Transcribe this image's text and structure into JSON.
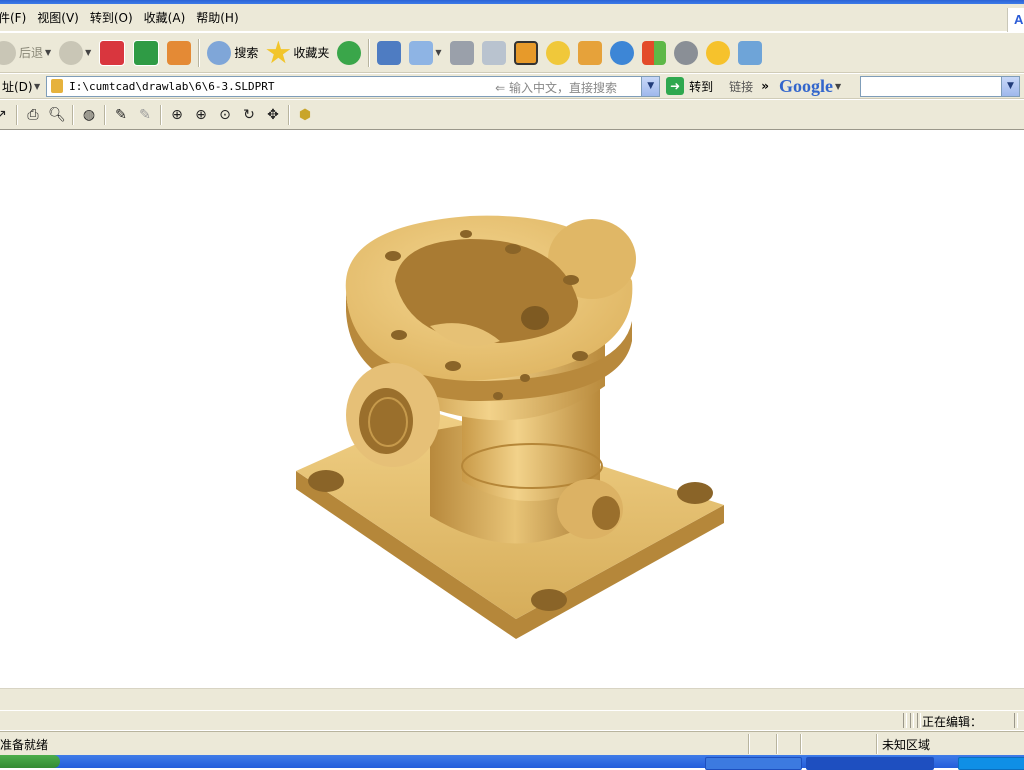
{
  "window": {
    "address_label": "址(D)",
    "address_url": "I:\\cumtcad\\drawlab\\6\\6-3.SLDPRT",
    "search_placeholder": "输入中文，直接搜索",
    "go_label": "转到",
    "links_label": "链接",
    "links_chevron": "»",
    "google_label": "Google",
    "windows_logo_letter": "A"
  },
  "menubar": {
    "items": [
      "件(F)",
      "视图(V)",
      "转到(O)",
      "收藏(A)",
      "帮助(H)"
    ]
  },
  "toolbar": {
    "back_label": "后退",
    "search_label": "搜索",
    "favorites_label": "收藏夹"
  },
  "statusbar": {
    "editing_label": "正在编辑："
  },
  "ie_status": {
    "ready": "准备就绪",
    "zone": "未知区域"
  },
  "colors": {
    "chrome": "#ece9d8",
    "part_gold": "#e2bb65",
    "part_shadow": "#b3863a",
    "taskbar": "#245edb"
  },
  "icons": {
    "back": "back-arrow-icon",
    "forward": "forward-arrow-icon",
    "stop": "stop-icon",
    "refresh": "refresh-icon",
    "home": "home-icon",
    "search": "search-magnifier-icon",
    "favorites": "star-icon",
    "history": "history-icon",
    "mail": "mail-icon",
    "print": "printer-icon",
    "edit": "edit-icon",
    "media": "media-play-icon",
    "messenger": "messenger-icon",
    "google_search_box": "dropdown-icon"
  }
}
